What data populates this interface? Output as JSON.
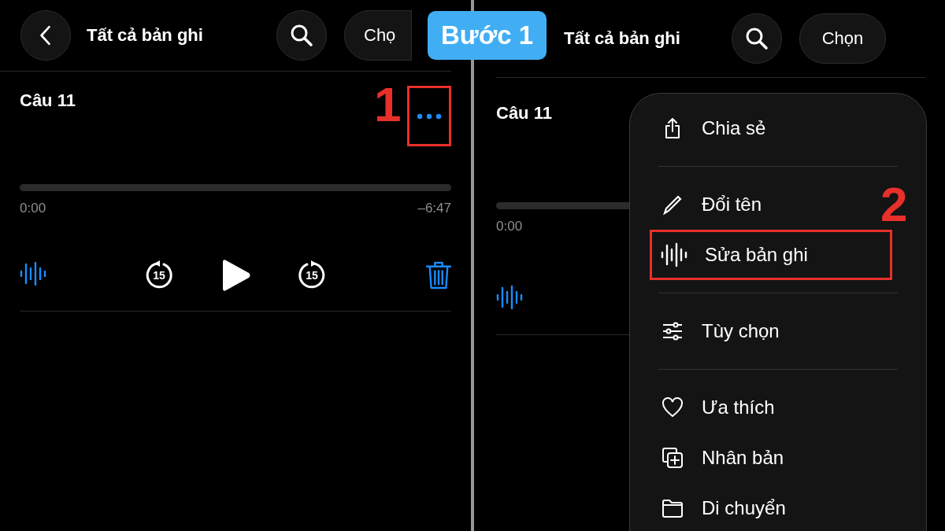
{
  "step_badge": "Bước 1",
  "panels": [
    {
      "header": {
        "title": "Tất cả bản ghi",
        "select_button": "Chọ"
      },
      "recording": {
        "title": "Câu 11",
        "more_annotated": true,
        "marker": "1",
        "elapsed": "0:00",
        "remaining": "–6:47",
        "skip_back": "15",
        "skip_forward": "15"
      }
    },
    {
      "header": {
        "title": "Tất cả bản ghi",
        "select_button": "Chọn"
      },
      "recording": {
        "title": "Câu 11",
        "elapsed": "0:00"
      },
      "menu": {
        "marker": "2",
        "sections": [
          {
            "items": [
              {
                "label": "Chia sẻ",
                "kind": "share",
                "annotated": false
              }
            ]
          },
          {
            "items": [
              {
                "label": "Đổi tên",
                "kind": "pencil",
                "annotated": false
              },
              {
                "label": "Sửa bản ghi",
                "kind": "waveform",
                "annotated": true
              }
            ]
          },
          {
            "items": [
              {
                "label": "Tùy chọn",
                "kind": "sliders",
                "annotated": false
              }
            ]
          },
          {
            "items": [
              {
                "label": "Ưa thích",
                "kind": "heart",
                "annotated": false
              },
              {
                "label": "Nhân bản",
                "kind": "duplicate",
                "annotated": false
              },
              {
                "label": "Di chuyển",
                "kind": "folder",
                "annotated": false
              }
            ]
          }
        ]
      }
    }
  ]
}
